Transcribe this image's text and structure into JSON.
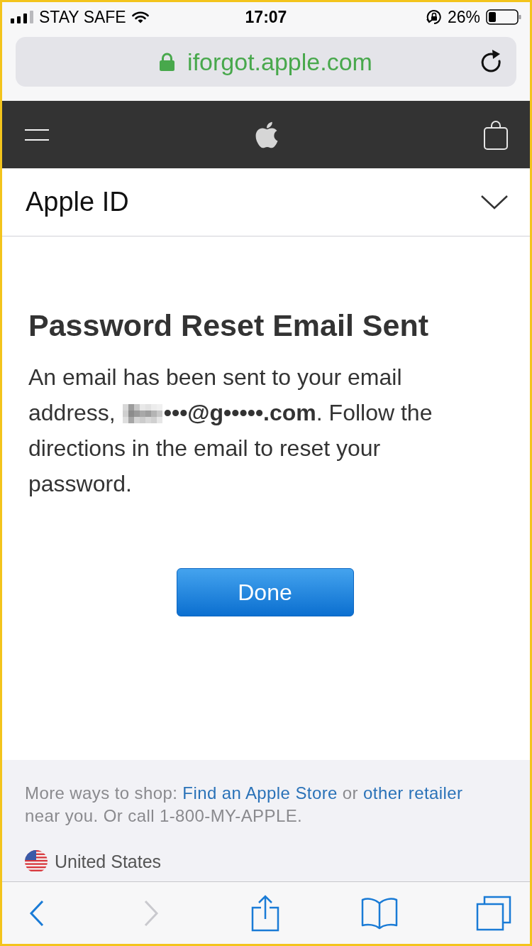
{
  "status_bar": {
    "carrier": "STAY SAFE",
    "time": "17:07",
    "battery": "26%"
  },
  "address_bar": {
    "url": "iforgot.apple.com",
    "secure": true
  },
  "section_header": {
    "title": "Apple ID",
    "expanded": false
  },
  "message": {
    "title": "Password Reset Email Sent",
    "intro": "An email has been sent to your email address,",
    "email": "•••@g•••••.com",
    "outro": ". Follow the directions in the email to reset your password."
  },
  "done_button": {
    "label": "Done"
  },
  "footer": {
    "shop_text": [
      {
        "kind": "text",
        "text": "More ways to shop: "
      },
      {
        "kind": "link",
        "text": "Find an Apple Store"
      },
      {
        "kind": "text",
        "text": " or "
      },
      {
        "kind": "link",
        "text": "other retailer"
      },
      {
        "kind": "text",
        "text": " near you. Or call 1-800-MY-APPLE."
      }
    ],
    "country": "United States"
  },
  "toolbar": [
    {
      "kind": "back",
      "disabled": false
    },
    {
      "kind": "forward",
      "disabled": true
    },
    {
      "kind": "share",
      "disabled": false
    },
    {
      "kind": "bookmarks",
      "disabled": false
    },
    {
      "kind": "tabs",
      "disabled": false
    }
  ]
}
